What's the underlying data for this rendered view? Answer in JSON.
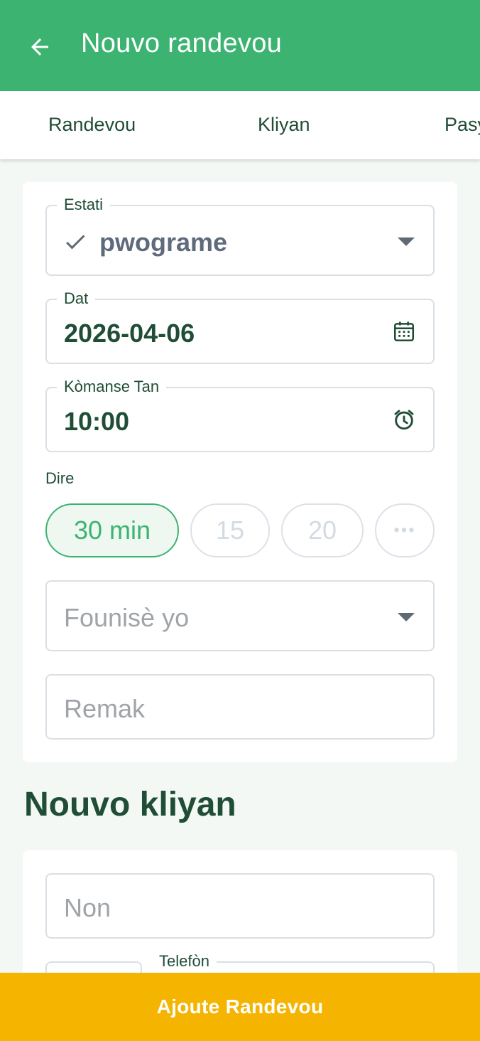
{
  "appbar": {
    "title": "Nouvo randevou",
    "back_icon": "arrow-left-icon"
  },
  "tabs": [
    {
      "label": "Randevou"
    },
    {
      "label": "Kliyan"
    },
    {
      "label": "Pasy"
    }
  ],
  "appointment": {
    "status": {
      "label": "Estati",
      "value": "pwograme",
      "icon": "check-icon"
    },
    "date": {
      "label": "Dat",
      "value": "2026-04-06",
      "icon": "calendar-icon"
    },
    "start_time": {
      "label": "Kòmanse Tan",
      "value": "10:00",
      "icon": "alarm-clock-icon"
    },
    "duration": {
      "label": "Dire",
      "options": [
        "30 min",
        "15",
        "20",
        "•••"
      ],
      "selected": "30 min"
    },
    "provider": {
      "placeholder": "Founisè yo"
    },
    "notes": {
      "placeholder": "Remak"
    }
  },
  "new_client": {
    "heading": "Nouvo kliyan",
    "name": {
      "placeholder": "Non"
    },
    "phone": {
      "label": "Telefòn"
    }
  },
  "footer": {
    "button_label": "Ajoute Randevou"
  },
  "colors": {
    "primary": "#3cb371",
    "accent": "#f4b400",
    "text_dark": "#1f4d35",
    "border": "#d9dfe4"
  }
}
